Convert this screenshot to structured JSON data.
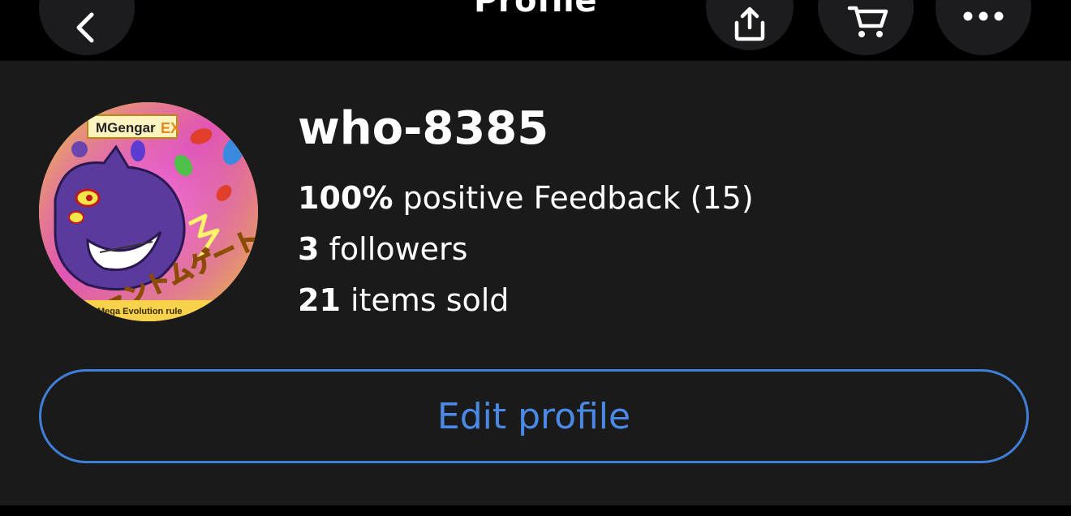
{
  "header": {
    "title": "Profile",
    "back_icon": "chevron-left-icon",
    "share_icon": "share-icon",
    "cart_icon": "cart-icon",
    "more_icon": "more-horizontal-icon"
  },
  "profile": {
    "username": "who-8385",
    "avatar": {
      "description_icon": "avatar-image",
      "card_name": "MGengar",
      "card_tag": "EX",
      "card_rule": "Mega Evolution rule",
      "card_japanese": "ファントムゲート"
    },
    "feedback_percent": "100%",
    "feedback_text": " positive Feedback (15)",
    "followers_count": "3",
    "followers_text": " followers",
    "sold_count": "21",
    "sold_text": " items sold"
  },
  "actions": {
    "edit_profile_label": "Edit profile"
  },
  "colors": {
    "background": "#000000",
    "panel": "#1a1a1b",
    "accent": "#4a8ae6"
  }
}
